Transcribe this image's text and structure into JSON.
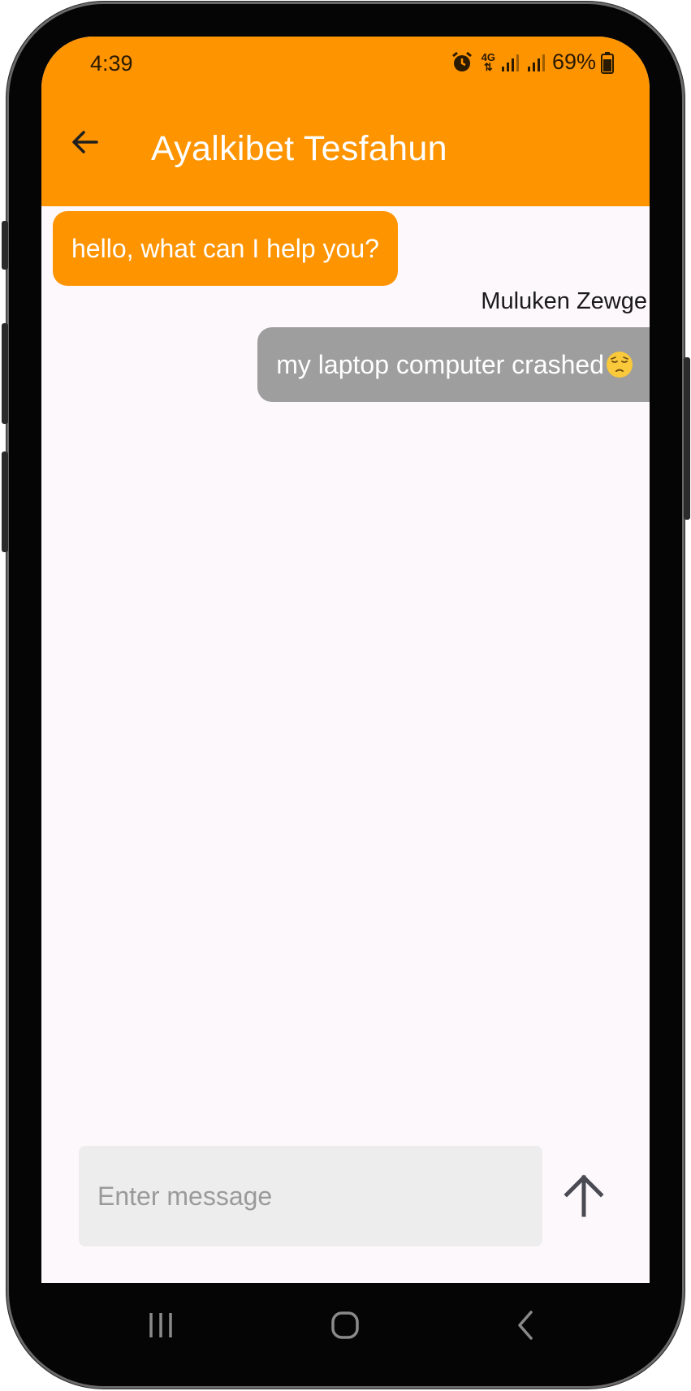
{
  "status_bar": {
    "time": "4:39",
    "network": "4G",
    "battery_percent": "69%",
    "icons": [
      "alarm-icon",
      "network-4g-icon",
      "signal-icon",
      "signal-icon",
      "battery-icon"
    ]
  },
  "app_bar": {
    "title": "Ayalkibet Tesfahun",
    "back_icon": "arrow-back-icon",
    "background_color": "#fe9400"
  },
  "messages": [
    {
      "direction": "received",
      "text": "hello, what can I help you?",
      "bubble_color": "#fe9400"
    },
    {
      "direction": "sent",
      "sender": "Muluken Zewge",
      "text": "my laptop computer crashed",
      "emoji": "pensive-face-icon",
      "bubble_color": "#9e9e9e"
    }
  ],
  "composer": {
    "placeholder": "Enter message",
    "value": "",
    "send_icon": "arrow-up-icon"
  },
  "nav_bar": {
    "icons": [
      "recent-apps-icon",
      "home-icon",
      "back-icon"
    ]
  }
}
